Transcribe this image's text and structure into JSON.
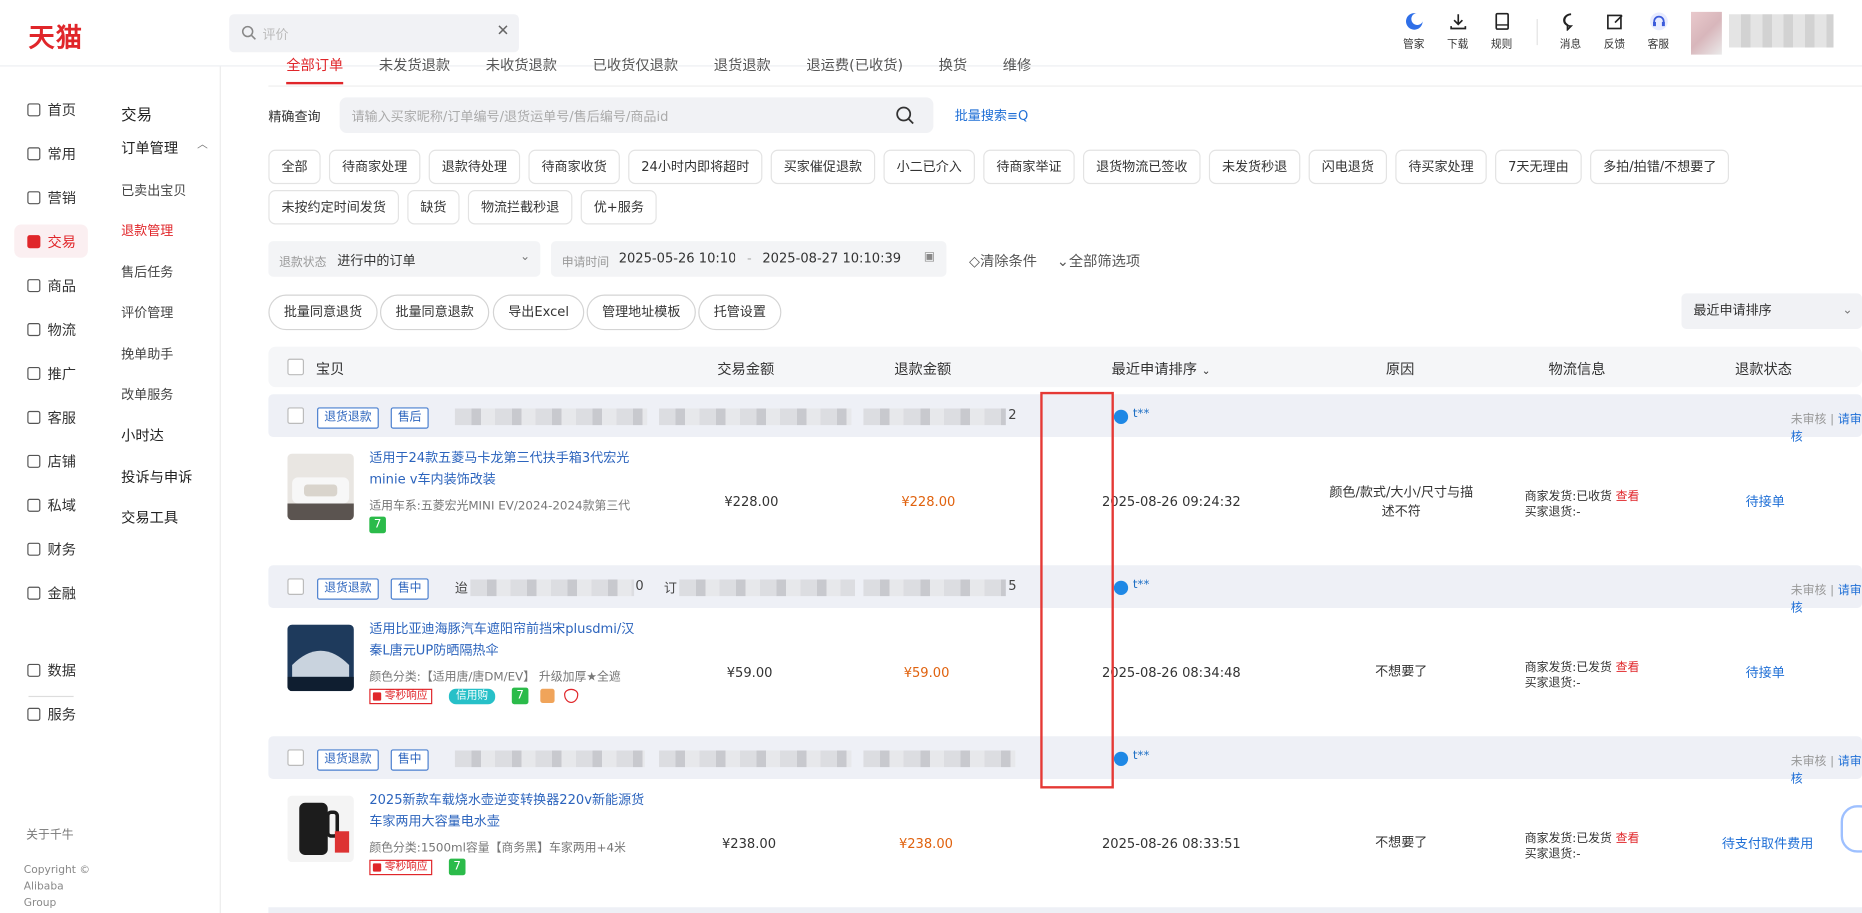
{
  "app": {
    "logo": "天猫"
  },
  "search": {
    "placeholder": "评价"
  },
  "top_tools": [
    {
      "label": "管家",
      "icon": "moon-icon"
    },
    {
      "label": "下载",
      "icon": "download-icon"
    },
    {
      "label": "规则",
      "icon": "book-icon"
    },
    {
      "label": "消息",
      "icon": "chat-icon"
    },
    {
      "label": "反馈",
      "icon": "edit-icon"
    },
    {
      "label": "客服",
      "icon": "headset-icon"
    }
  ],
  "nav1": [
    "首页",
    "常用",
    "营销",
    "交易",
    "商品",
    "物流",
    "推广",
    "客服",
    "店铺",
    "私域",
    "财务",
    "金融",
    "数据",
    "服务"
  ],
  "nav1_active": "交易",
  "nav1_footer": {
    "about": "关于千牛",
    "copyright": "Copyright © Alibaba Group"
  },
  "nav2": {
    "title": "交易",
    "group": "订单管理",
    "items": [
      "已卖出宝贝",
      "退款管理",
      "售后任务",
      "评价管理",
      "挽单助手",
      "改单服务"
    ],
    "active": "退款管理",
    "sections": [
      "小时达",
      "投诉与申诉",
      "交易工具"
    ]
  },
  "tabs": [
    "全部订单",
    "未发货退款",
    "未收货退款",
    "已收货仅退款",
    "退货退款",
    "退运费(已收货)",
    "换货",
    "维修"
  ],
  "query": {
    "label": "精确查询",
    "placeholder": "请输入买家昵称/订单编号/退货运单号/售后编号/商品id",
    "batch": "批量搜索≡Q"
  },
  "chips": [
    "全部",
    "待商家处理",
    "退款待处理",
    "待商家收货",
    "24小时内即将超时",
    "买家催促退款",
    "小二已介入",
    "待商家举证",
    "退货物流已签收",
    "未发货秒退",
    "闪电退货",
    "待买家处理",
    "7天无理由",
    "多拍/拍错/不想要了",
    "未按约定时间发货",
    "缺货",
    "物流拦截秒退",
    "优+服务"
  ],
  "filters": {
    "status_label": "退款状态",
    "status_value": "进行中的订单",
    "time_label": "申请时间",
    "time_start": "2025-05-26 10:10:39",
    "time_sep": "-",
    "time_end": "2025-08-27 10:10:39",
    "clear": "清除条件",
    "all": "全部筛选项"
  },
  "actions": [
    "批量同意退货",
    "批量同意退款",
    "导出Excel",
    "管理地址模板",
    "托管设置"
  ],
  "sort": "最近申请排序",
  "table_headers": {
    "item": "宝贝",
    "trade": "交易金额",
    "refund": "退款金额",
    "time": "最近申请排序",
    "reason": "原因",
    "logistics": "物流信息",
    "status": "退款状态"
  },
  "orders": [
    {
      "tags": [
        "退货退款",
        "售后"
      ],
      "tail": "2",
      "buyer": "t**",
      "audit": "未审核",
      "audit_link": "请审核",
      "flag_color": "#e0262a",
      "title": "适用于24款五菱马卡龙第三代扶手箱3代宏光minie v车内装饰改装",
      "sku": "适用车系:五菱宏光MINI EV/2024-2024款第三代",
      "badges": [
        "7"
      ],
      "trade": "¥228.00",
      "refund": "¥228.00",
      "time": "2025-08-26 09:24:32",
      "reason": "颜色/款式/大小/尺寸与描述不符",
      "ship_label": "商家发货:",
      "ship": "已收货",
      "view": "查看",
      "ret_label": "买家退货:",
      "ret": "-",
      "status": "待接单"
    },
    {
      "tags": [
        "退货退款",
        "售中"
      ],
      "prefix1": "迨",
      "tail1": "0",
      "prefix2": "订",
      "tail": "5",
      "buyer": "t**",
      "audit": "未审核",
      "audit_link": "请审核",
      "flag_color": "#8a8a8a",
      "title": "适用比亚迪海豚汽车遮阳帘前挡宋plusdmi/汉秦L唐元UP防晒隔热伞",
      "sku": "颜色分类:【适用唐/唐DM/EV】 升级加厚★全遮",
      "badges": [
        "零秒响应",
        "信用购",
        "7"
      ],
      "trade": "¥59.00",
      "refund": "¥59.00",
      "time": "2025-08-26 08:34:48",
      "reason": "不想要了",
      "ship_label": "商家发货:",
      "ship": "已发货",
      "view": "查看",
      "ret_label": "买家退货:",
      "ret": "-",
      "status": "待接单"
    },
    {
      "tags": [
        "退货退款",
        "售中"
      ],
      "buyer": "t**",
      "audit": "未审核",
      "audit_link": "请审核",
      "flag_color": "#8a8a8a",
      "title": "2025新款车载烧水壶逆变转换器220v新能源货车家两用大容量电水壶",
      "sku": "颜色分类:1500ml容量【商务黑】车家两用+4米",
      "badges": [
        "零秒响应",
        "7"
      ],
      "trade": "¥238.00",
      "refund": "¥238.00",
      "time": "2025-08-26 08:33:51",
      "reason": "不想要了",
      "ship_label": "商家发货:",
      "ship": "已发货",
      "view": "查看",
      "ret_label": "买家退货:",
      "ret": "-",
      "status": "待支付取件费用"
    }
  ]
}
